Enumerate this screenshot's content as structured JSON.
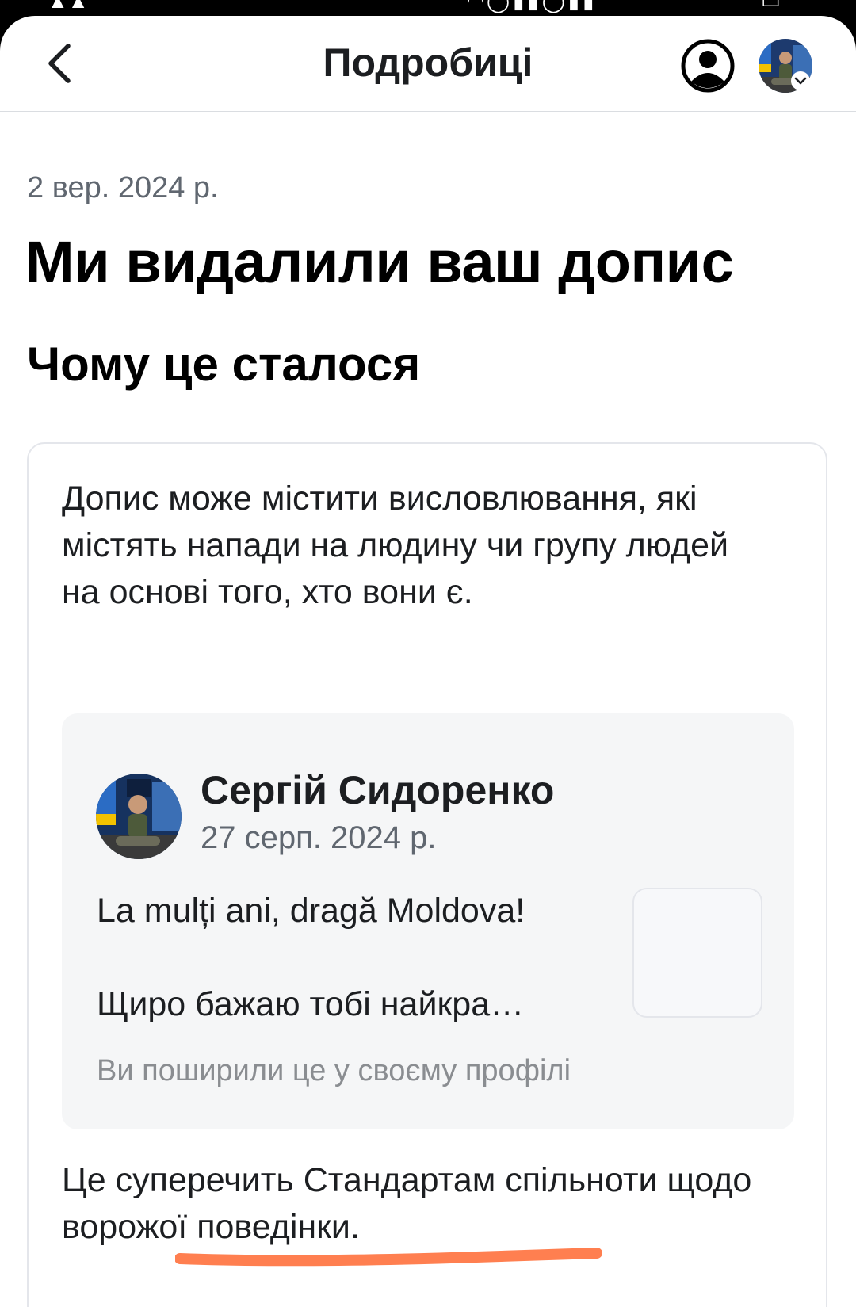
{
  "page_header": {
    "title": "Подробиці",
    "back_icon": "chevron-left-icon",
    "profile_icon": "user-circle-icon",
    "avatar_icon": "account-avatar"
  },
  "notice": {
    "date": "2 вер. 2024 р.",
    "headline": "Ми видалили ваш допис"
  },
  "reason": {
    "heading": "Чому це сталося",
    "text": "Допис може містити висловлювання, які містять напади на людину чи групу людей на основі того, хто вони є.",
    "policy_text": "Це суперечить Стандартам спільноти щодо ворожої поведінки."
  },
  "post": {
    "author": "Сергій Сидоренко",
    "date": "27 серп. 2024 р.",
    "line1": "La mulți ani, dragă Moldova!",
    "line2": "Щиро бажаю тобі найкра…",
    "shared_note": "Ви поширили це у своєму профілі"
  },
  "colors": {
    "text_primary": "#1c1e21",
    "text_secondary": "#606770",
    "text_tertiary": "#8a8d91",
    "card_border": "#e4e6eb",
    "post_bg": "#f5f6f7",
    "underline_annotation": "#ff7f50"
  }
}
